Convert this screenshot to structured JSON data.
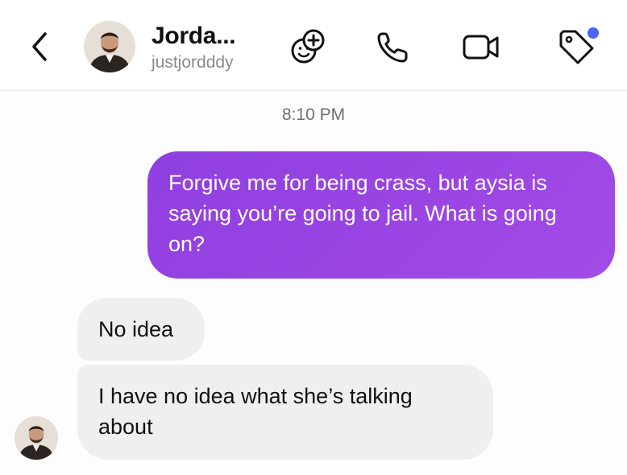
{
  "header": {
    "back_icon": "chevron-left-icon",
    "contact_name": "Jorda...",
    "username": "justjordddy",
    "actions": [
      {
        "icon": "sticker-add-icon"
      },
      {
        "icon": "phone-icon"
      },
      {
        "icon": "video-camera-icon"
      },
      {
        "icon": "tag-icon"
      }
    ],
    "notification_dot_color": "#4a64f5"
  },
  "conversation": {
    "timestamp": "8:10 PM",
    "messages": [
      {
        "direction": "outgoing",
        "text": "Forgive me for being crass, but aysia is saying you’re going to jail. What is going on?"
      },
      {
        "direction": "incoming",
        "text": "No idea"
      },
      {
        "direction": "incoming",
        "text": "I have no idea what she’s talking about"
      }
    ]
  },
  "colors": {
    "outgoing_bubble": "#9b45e4",
    "incoming_bubble": "#efefef"
  }
}
